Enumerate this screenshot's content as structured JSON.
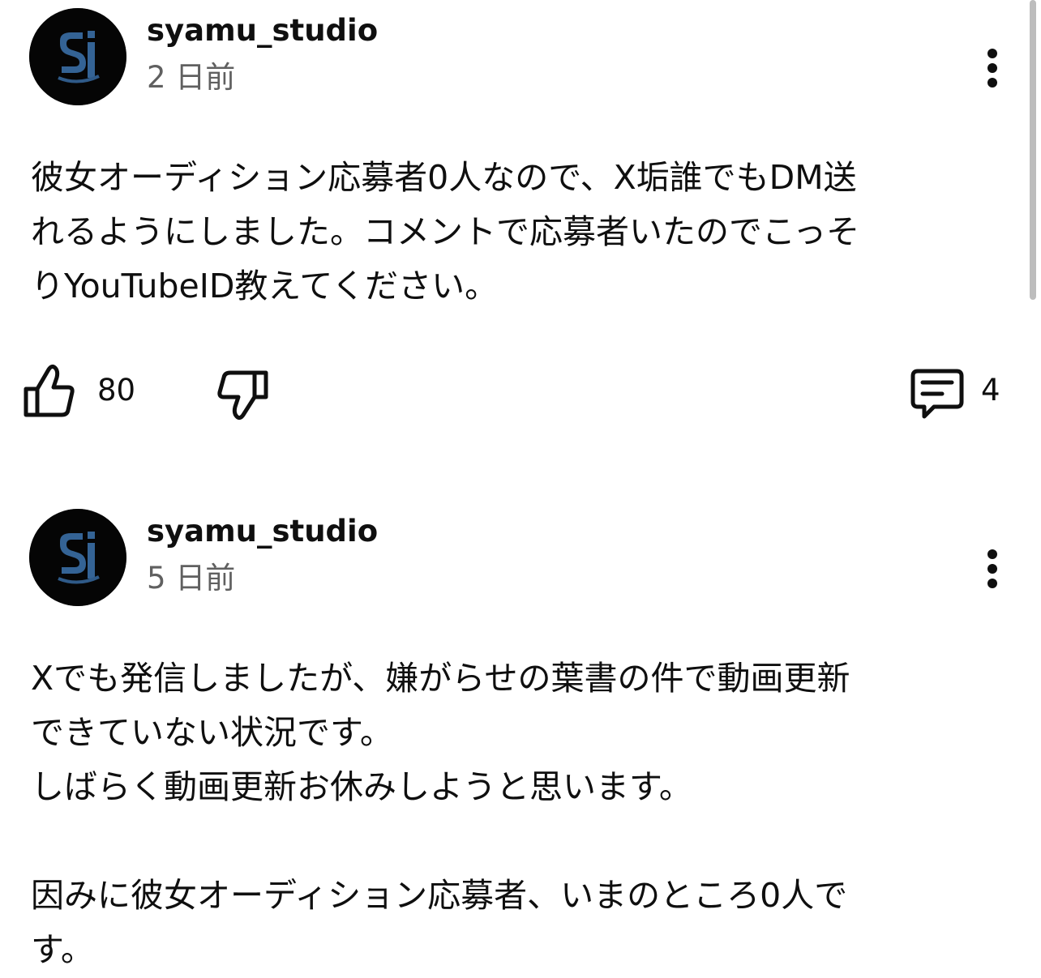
{
  "posts": [
    {
      "author": "syamu_studio",
      "time": "2 日前",
      "lines": [
        "彼女オーディション応募者0人なので、X垢誰でもDM送",
        "れるようにしました。コメントで応募者いたのでこっそ",
        "りYouTubeID教えてください。"
      ],
      "likes": "80",
      "comments": "4",
      "icons": {
        "menu": "more-vert-icon",
        "like": "thumbs-up-icon",
        "dislike": "thumbs-down-icon",
        "comment": "comment-icon"
      }
    },
    {
      "author": "syamu_studio",
      "time": "5 日前",
      "lines": [
        "Xでも発信しましたが、嫌がらせの葉書の件で動画更新",
        "できていない状況です。",
        "しばらく動画更新お休みしようと思います。",
        "",
        "因みに彼女オーディション応募者、いまのところ0人で",
        "す。"
      ],
      "icons": {
        "menu": "more-vert-icon"
      }
    }
  ],
  "colors": {
    "text": "#0f0f0f",
    "secondary": "#606060",
    "avatar_bg": "#050505",
    "avatar_logo": "#3a6ea5"
  }
}
